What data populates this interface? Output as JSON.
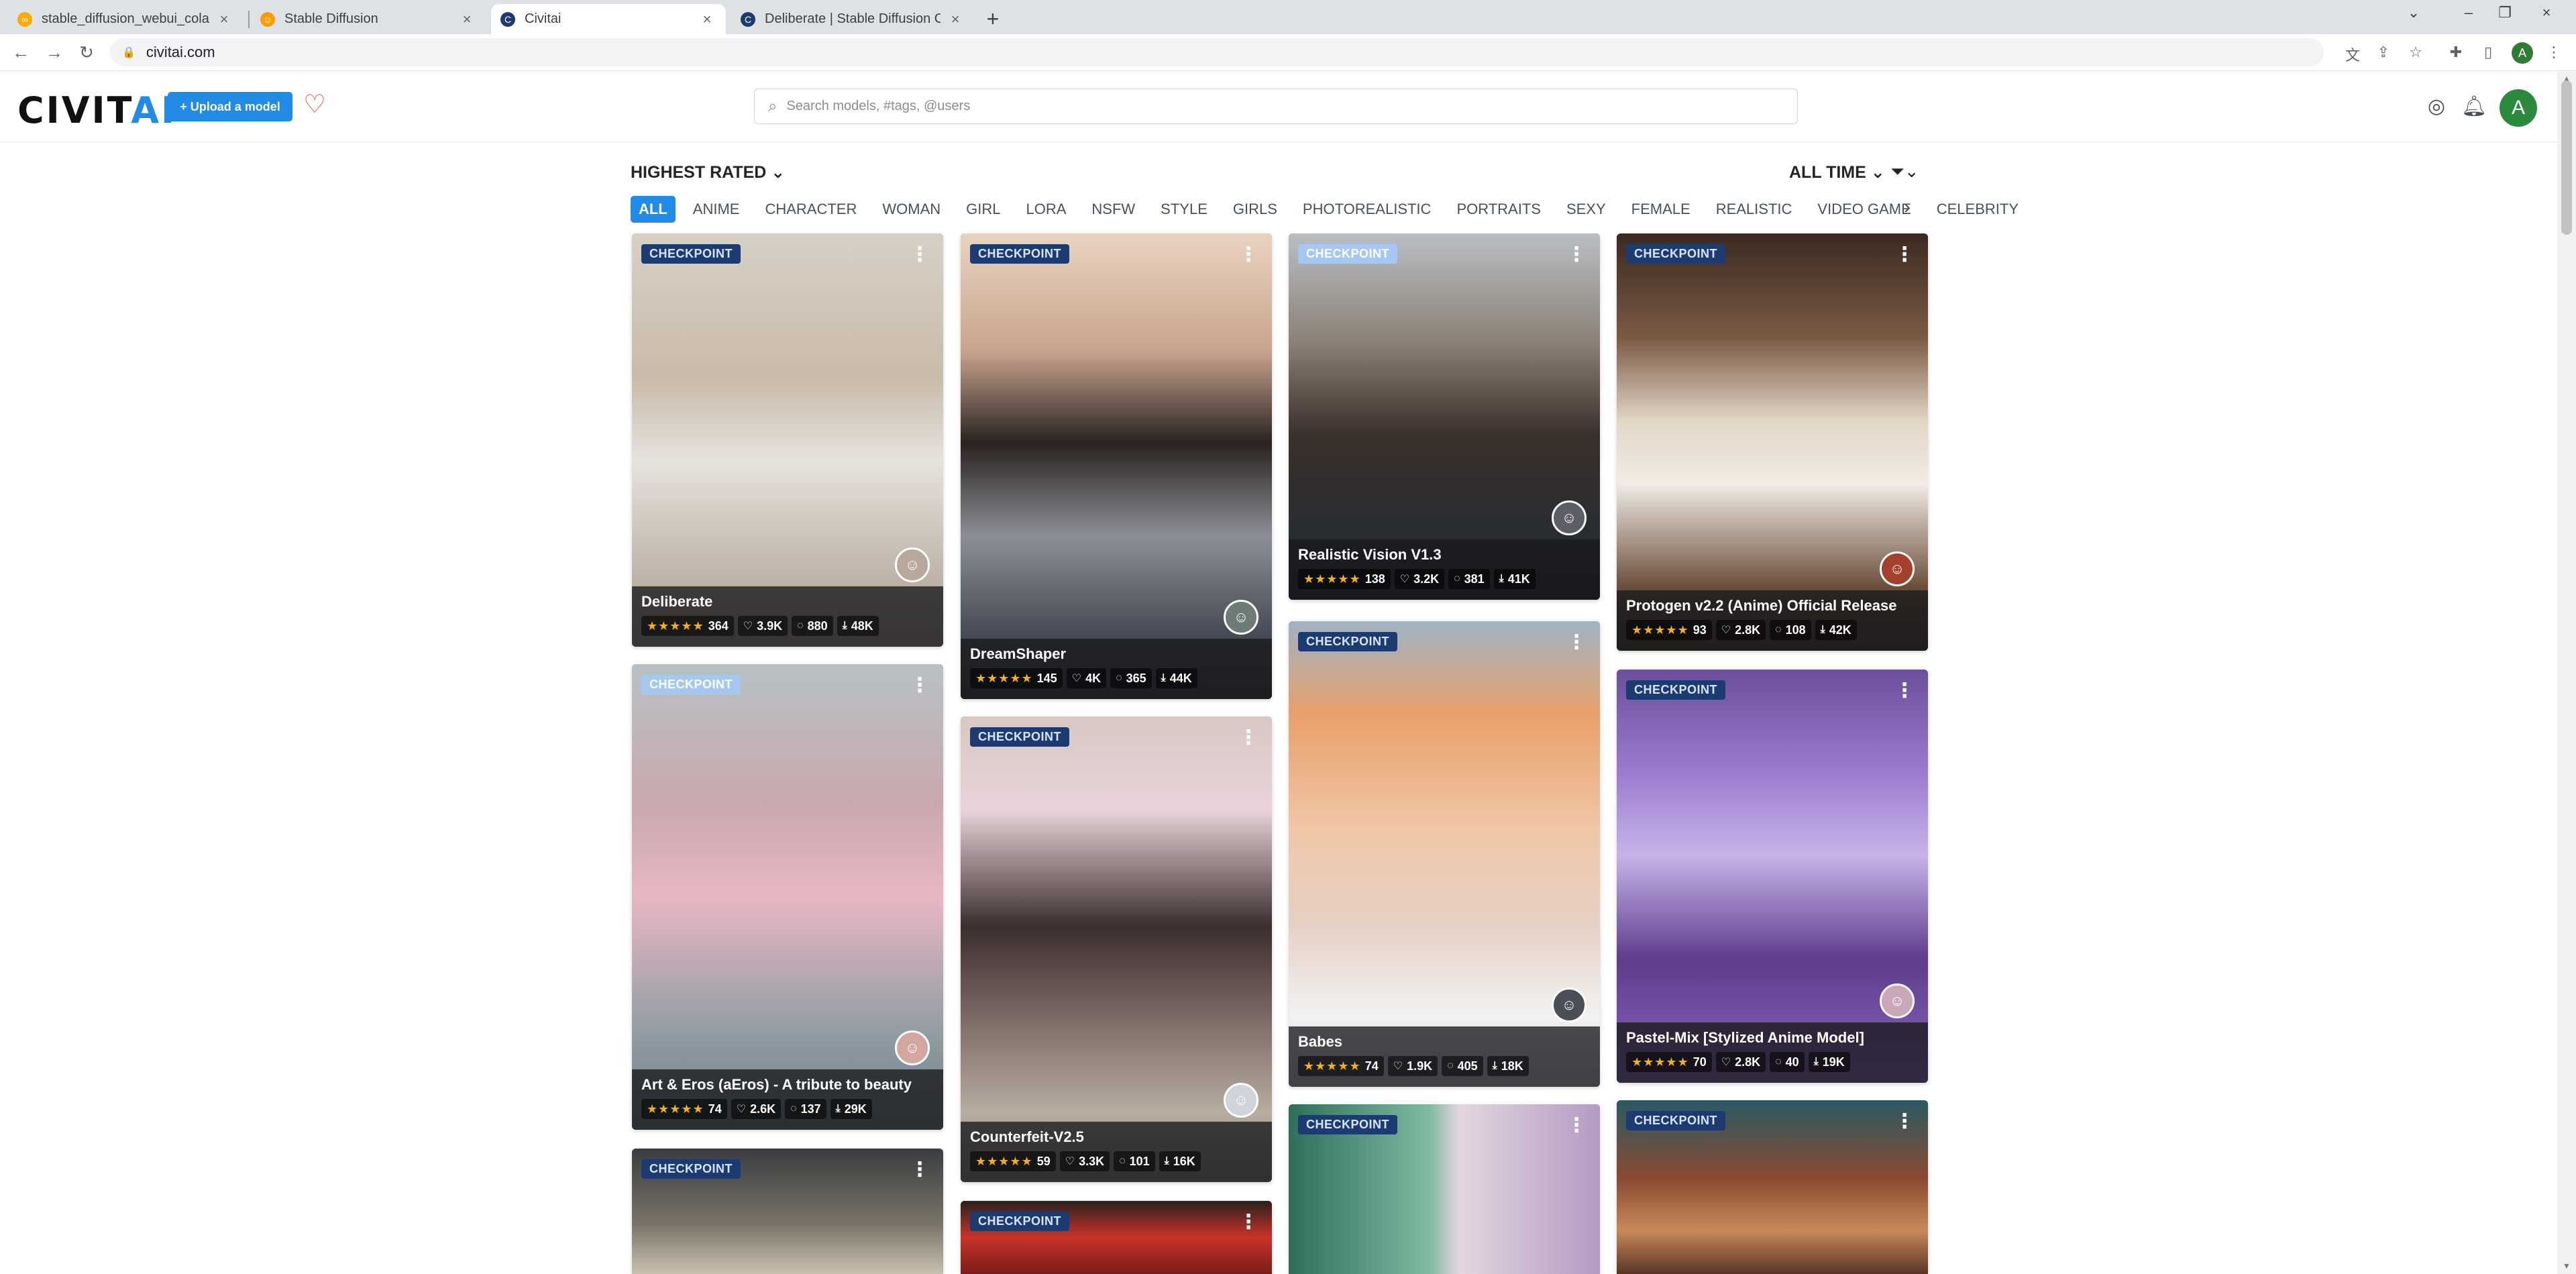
{
  "browser": {
    "tabs": [
      {
        "title": "stable_diffusion_webui_colab.i",
        "favicon": "colab-icon"
      },
      {
        "title": "Stable Diffusion",
        "favicon": "hf-icon"
      },
      {
        "title": "Civitai",
        "favicon": "civitai-icon"
      },
      {
        "title": "Deliberate | Stable Diffusion C",
        "favicon": "civitai-icon"
      }
    ],
    "url": "civitai.com",
    "profile_initial": "A"
  },
  "header": {
    "logo_left": "CIVIT",
    "logo_right": "AI",
    "upload_label": "+ Upload a model",
    "search_placeholder": "Search models, #tags, @users",
    "avatar_initial": "A"
  },
  "filters": {
    "sort_label": "HIGHEST RATED",
    "period_label": "ALL TIME",
    "tags": [
      "ALL",
      "ANIME",
      "CHARACTER",
      "WOMAN",
      "GIRL",
      "LORA",
      "NSFW",
      "STYLE",
      "GIRLS",
      "PHOTOREALISTIC",
      "PORTRAITS",
      "SEXY",
      "FEMALE",
      "REALISTIC",
      "VIDEO GAME",
      "CELEBRITY"
    ],
    "active_tag": "ALL"
  },
  "colors": {
    "accent": "#228be6",
    "heart": "#fa5252",
    "star": "#fab005"
  },
  "cards": [
    {
      "badge": "CHECKPOINT",
      "name": "Deliberate",
      "rating": "364",
      "likes": "3.9K",
      "comments": "880",
      "downloads": "48K"
    },
    {
      "badge": "CHECKPOINT",
      "name": "DreamShaper",
      "rating": "145",
      "likes": "4K",
      "comments": "365",
      "downloads": "44K"
    },
    {
      "badge": "CHECKPOINT",
      "name": "Realistic Vision V1.3",
      "rating": "138",
      "likes": "3.2K",
      "comments": "381",
      "downloads": "41K"
    },
    {
      "badge": "CHECKPOINT",
      "name": "Protogen v2.2 (Anime) Official Release",
      "rating": "93",
      "likes": "2.8K",
      "comments": "108",
      "downloads": "42K"
    },
    {
      "badge": "CHECKPOINT",
      "name": "Art & Eros (aEros) - A tribute to beauty",
      "rating": "74",
      "likes": "2.6K",
      "comments": "137",
      "downloads": "29K"
    },
    {
      "badge": "CHECKPOINT",
      "name": "Counterfeit-V2.5",
      "rating": "59",
      "likes": "3.3K",
      "comments": "101",
      "downloads": "16K"
    },
    {
      "badge": "CHECKPOINT",
      "name": "Babes",
      "rating": "74",
      "likes": "1.9K",
      "comments": "405",
      "downloads": "18K"
    },
    {
      "badge": "CHECKPOINT",
      "name": "Pastel-Mix [Stylized Anime Model]",
      "rating": "70",
      "likes": "2.8K",
      "comments": "40",
      "downloads": "19K"
    },
    {
      "badge": "CHECKPOINT"
    },
    {
      "badge": "CHECKPOINT"
    },
    {
      "badge": "CHECKPOINT"
    },
    {
      "badge": "CHECKPOINT"
    }
  ]
}
